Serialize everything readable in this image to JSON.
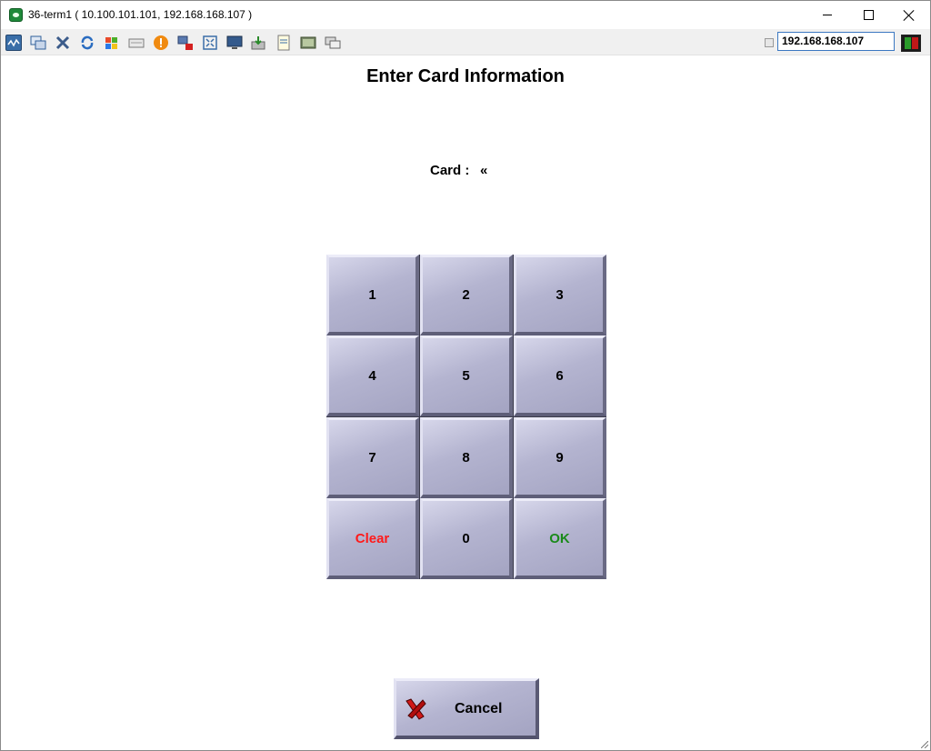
{
  "window": {
    "title": "36-term1 ( 10.100.101.101, 192.168.168.107 )"
  },
  "toolbar": {
    "icons": [
      "monitor-icon",
      "windows-icon",
      "tools-icon",
      "refresh-icon",
      "windows-logo-icon",
      "keyboard-icon",
      "alert-icon",
      "disconnect-icon",
      "fullscreen-icon",
      "display-icon",
      "download-icon",
      "notes-icon",
      "screen-icon",
      "chat-icon"
    ],
    "ip_value": "192.168.168.107"
  },
  "main": {
    "heading": "Enter Card Information",
    "card_label": "Card :",
    "card_value": "«"
  },
  "keypad": {
    "keys": [
      "1",
      "2",
      "3",
      "4",
      "5",
      "6",
      "7",
      "8",
      "9",
      "Clear",
      "0",
      "OK"
    ]
  },
  "cancel": {
    "label": "Cancel"
  },
  "colors": {
    "key_face": "#b4b4d0",
    "clear_text": "#ff1a1a",
    "ok_text": "#1a8a1a",
    "accent": "#3b78c2"
  }
}
